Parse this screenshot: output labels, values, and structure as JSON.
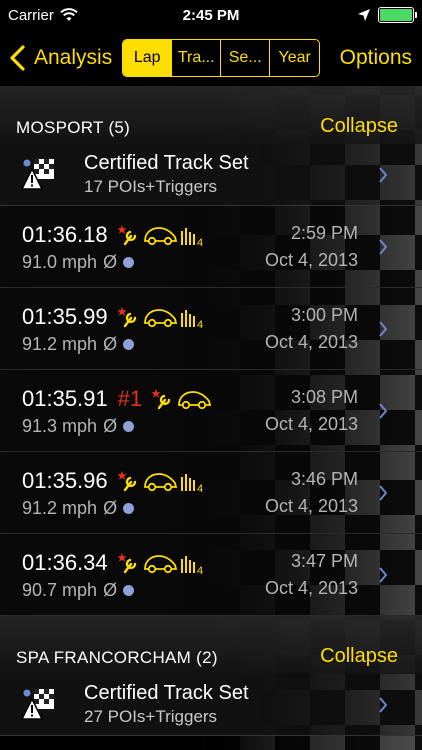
{
  "status_bar": {
    "carrier": "Carrier",
    "time": "2:45 PM",
    "battery_level": 1.0
  },
  "nav": {
    "back_label": "Analysis",
    "segments": [
      {
        "label": "Lap",
        "active": true
      },
      {
        "label": "Tra...",
        "active": false
      },
      {
        "label": "Se...",
        "active": false
      },
      {
        "label": "Year",
        "active": false
      }
    ],
    "options_label": "Options"
  },
  "colors": {
    "accent": "#fedd00",
    "rank_red": "#e0301e",
    "dot_blue": "#8fa0d8"
  },
  "sections": [
    {
      "title": "MOSPORT (5)",
      "collapse_label": "Collapse",
      "cert": {
        "title": "Certified Track Set",
        "subtitle": "17 POIs+Triggers",
        "icon": "track-set-warning-icon"
      },
      "laps": [
        {
          "time": "01:36.18",
          "rank": "",
          "speed": "91.0 mph",
          "avg_symbol": "Ø",
          "clock": "2:59 PM",
          "date": "Oct 4, 2013",
          "signal": "4",
          "has_signal": true
        },
        {
          "time": "01:35.99",
          "rank": "",
          "speed": "91.2 mph",
          "avg_symbol": "Ø",
          "clock": "3:00 PM",
          "date": "Oct 4, 2013",
          "signal": "4",
          "has_signal": true
        },
        {
          "time": "01:35.91",
          "rank": "#1",
          "speed": "91.3 mph",
          "avg_symbol": "Ø",
          "clock": "3:08 PM",
          "date": "Oct 4, 2013",
          "signal": "",
          "has_signal": false
        },
        {
          "time": "01:35.96",
          "rank": "",
          "speed": "91.2 mph",
          "avg_symbol": "Ø",
          "clock": "3:46 PM",
          "date": "Oct 4, 2013",
          "signal": "4",
          "has_signal": true
        },
        {
          "time": "01:36.34",
          "rank": "",
          "speed": "90.7 mph",
          "avg_symbol": "Ø",
          "clock": "3:47 PM",
          "date": "Oct 4, 2013",
          "signal": "4",
          "has_signal": true
        }
      ]
    },
    {
      "title": "SPA FRANCORCHAM (2)",
      "collapse_label": "Collapse",
      "cert": {
        "title": "Certified Track Set",
        "subtitle": "27 POIs+Triggers",
        "icon": "track-set-warning-icon"
      },
      "laps": []
    }
  ]
}
